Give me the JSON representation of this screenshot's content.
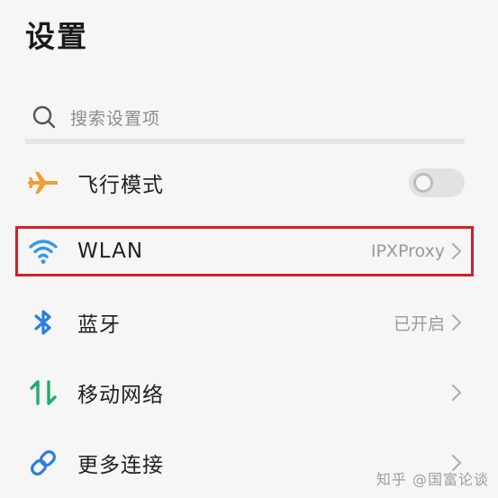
{
  "header": {
    "title": "设置"
  },
  "search": {
    "placeholder": "搜索设置项",
    "icon": "search-icon"
  },
  "items": [
    {
      "label": "飞行模式",
      "icon": "airplane-icon",
      "icon_color": "#f39c34",
      "toggle_on": false
    },
    {
      "label": "WLAN",
      "icon": "wifi-icon",
      "icon_color": "#2f9be8",
      "value": "IPXProxy"
    },
    {
      "label": "蓝牙",
      "icon": "bluetooth-icon",
      "icon_color": "#2a7fdc",
      "value": "已开启"
    },
    {
      "label": "移动网络",
      "icon": "mobile-data-icon",
      "icon_color": "#1fae6b"
    },
    {
      "label": "更多连接",
      "icon": "link-icon",
      "icon_color": "#2a7fdc"
    }
  ],
  "watermark": "知乎 @国富论谈",
  "colors": {
    "highlight": "#d0202a",
    "background": "#f6f6f6"
  }
}
